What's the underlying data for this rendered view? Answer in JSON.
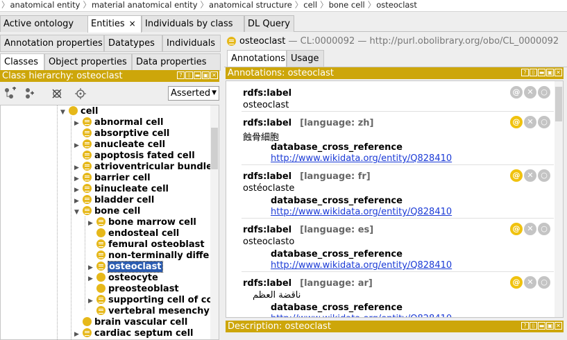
{
  "breadcrumb": [
    "anatomical entity",
    "material anatomical entity",
    "anatomical structure",
    "cell",
    "bone cell",
    "osteoclast"
  ],
  "main_tabs": [
    {
      "label": "Active ontology",
      "active": false
    },
    {
      "label": "Entities",
      "active": true,
      "close": "×"
    },
    {
      "label": "Individuals by class",
      "active": false
    },
    {
      "label": "DL Query",
      "active": false
    }
  ],
  "left_tabs_row1": [
    "Annotation properties",
    "Datatypes",
    "Individuals"
  ],
  "left_tabs_row2": [
    "Classes",
    "Object properties",
    "Data properties"
  ],
  "class_hierarchy": {
    "title": "Class hierarchy: osteoclast",
    "buttons": [
      "?",
      "⌷",
      "▬",
      "▣",
      "✕"
    ],
    "toolbar_icons": [
      "add-subclass-icon",
      "add-sibling-icon",
      "delete-class-icon",
      "find-icon"
    ],
    "mode": "Asserted",
    "rows": [
      {
        "label": "cell",
        "indent": 0,
        "toggle": "open",
        "lines": false
      },
      {
        "label": "abnormal cell",
        "indent": 1,
        "toggle": "closed",
        "lines": true
      },
      {
        "label": "absorptive cell",
        "indent": 1,
        "toggle": "",
        "lines": true
      },
      {
        "label": "anucleate cell",
        "indent": 1,
        "toggle": "closed",
        "lines": true
      },
      {
        "label": "apoptosis fated cell",
        "indent": 1,
        "toggle": "",
        "lines": true
      },
      {
        "label": "atrioventricular bundle",
        "indent": 1,
        "toggle": "closed",
        "lines": true
      },
      {
        "label": "barrier cell",
        "indent": 1,
        "toggle": "closed",
        "lines": true
      },
      {
        "label": "binucleate cell",
        "indent": 1,
        "toggle": "closed",
        "lines": true
      },
      {
        "label": "bladder cell",
        "indent": 1,
        "toggle": "closed",
        "lines": true
      },
      {
        "label": "bone cell",
        "indent": 1,
        "toggle": "open",
        "lines": true
      },
      {
        "label": "bone marrow cell",
        "indent": 2,
        "toggle": "closed",
        "lines": true
      },
      {
        "label": "endosteal cell",
        "indent": 2,
        "toggle": "",
        "lines": false
      },
      {
        "label": "femural osteoblast",
        "indent": 2,
        "toggle": "",
        "lines": true
      },
      {
        "label": "non-terminally diffe",
        "indent": 2,
        "toggle": "",
        "lines": true
      },
      {
        "label": "osteoclast",
        "indent": 2,
        "toggle": "closed",
        "lines": true,
        "selected": true
      },
      {
        "label": "osteocyte",
        "indent": 2,
        "toggle": "closed",
        "lines": false
      },
      {
        "label": "preosteoblast",
        "indent": 2,
        "toggle": "",
        "lines": false
      },
      {
        "label": "supporting cell of cc",
        "indent": 2,
        "toggle": "closed",
        "lines": true
      },
      {
        "label": "vertebral mesenchy",
        "indent": 2,
        "toggle": "",
        "lines": true
      },
      {
        "label": "brain vascular cell",
        "indent": 1,
        "toggle": "",
        "lines": false
      },
      {
        "label": "cardiac septum cell",
        "indent": 1,
        "toggle": "closed",
        "lines": true
      }
    ]
  },
  "entity": {
    "name": "osteoclast",
    "id_text": "— CL:0000092 — http://purl.obolibrary.org/obo/CL_0000092"
  },
  "right_tabs": [
    "Annotations",
    "Usage"
  ],
  "annotations_view": {
    "title": "Annotations: osteoclast",
    "entries": [
      {
        "property": "rdfs:label",
        "language": "",
        "value": "osteoclast",
        "sub_property": "",
        "link": "",
        "highlight": false
      },
      {
        "property": "rdfs:label",
        "language": "[language: zh]",
        "value": "蝕骨細胞",
        "sub_property": "database_cross_reference",
        "link": "http://www.wikidata.org/entity/Q828410",
        "highlight": true
      },
      {
        "property": "rdfs:label",
        "language": "[language: fr]",
        "value": "ostéoclaste",
        "sub_property": "database_cross_reference",
        "link": "http://www.wikidata.org/entity/Q828410",
        "highlight": true
      },
      {
        "property": "rdfs:label",
        "language": "[language: es]",
        "value": "osteoclasto",
        "sub_property": "database_cross_reference",
        "link": "http://www.wikidata.org/entity/Q828410",
        "highlight": true
      },
      {
        "property": "rdfs:label",
        "language": "[language: ar]",
        "value": "ناقضة العظم",
        "sub_property": "database_cross_reference",
        "link": "http://www.wikidata.org/entity/Q828410",
        "highlight": true
      }
    ],
    "actions": [
      "@",
      "✕",
      "○"
    ]
  },
  "description_view": {
    "title": "Description: osteoclast"
  },
  "colors": {
    "view_bar": "#cda60a",
    "class_dot": "#e6b81a",
    "selection": "#2a5bb0",
    "link": "#1a3ad6"
  }
}
